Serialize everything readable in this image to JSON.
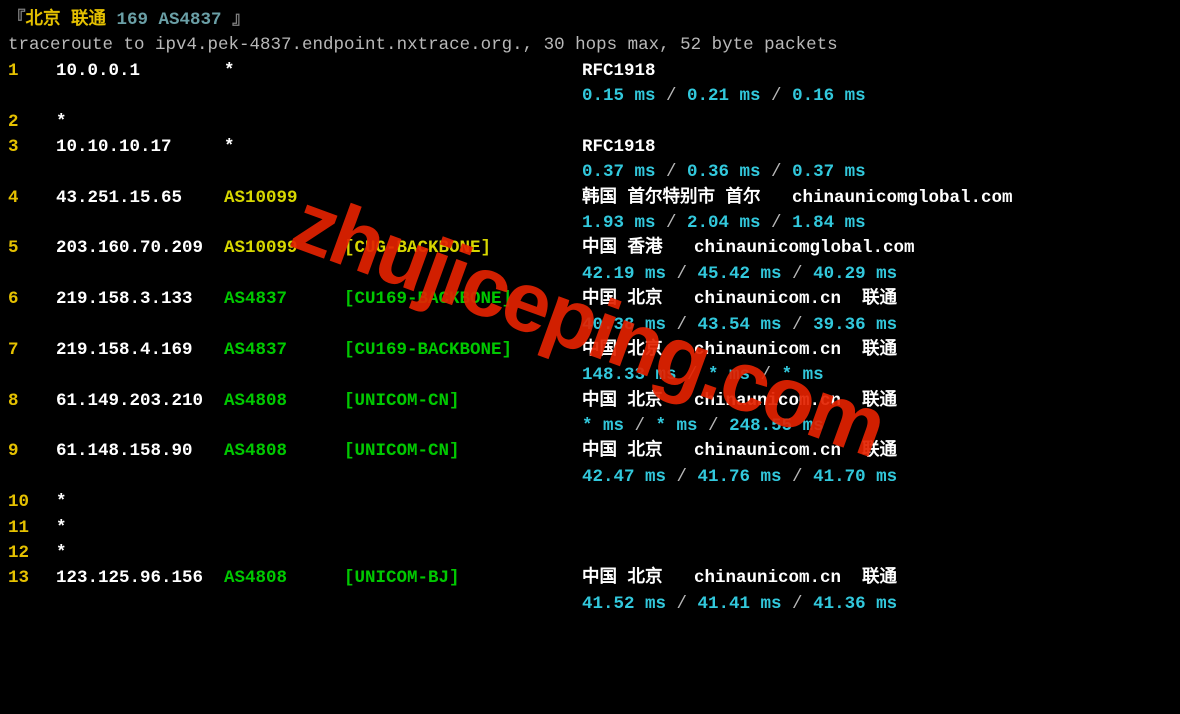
{
  "header": {
    "bracket_l": "『",
    "title_cn": "北京 联通",
    "title_badge": "169 AS4837",
    "bracket_r": "』"
  },
  "cmd": "traceroute to ipv4.pek-4837.endpoint.nxtrace.org., 30 hops max, 52 byte packets",
  "watermark": "zhujiceping.com",
  "hops": [
    {
      "n": "1",
      "ip": "10.0.0.1",
      "asn": "*",
      "asn_color": "white",
      "tag": "",
      "tag_color": "",
      "info": "RFC1918",
      "times": [
        "0.15 ms",
        "0.21 ms",
        "0.16 ms"
      ]
    },
    {
      "n": "2",
      "ip": "*",
      "asn": "",
      "asn_color": "",
      "tag": "",
      "tag_color": "",
      "info": "",
      "times": null
    },
    {
      "n": "3",
      "ip": "10.10.10.17",
      "asn": "*",
      "asn_color": "white",
      "tag": "",
      "tag_color": "",
      "info": "RFC1918",
      "times": [
        "0.37 ms",
        "0.36 ms",
        "0.37 ms"
      ]
    },
    {
      "n": "4",
      "ip": "43.251.15.65",
      "asn": "AS10099",
      "asn_color": "yellow",
      "tag": "",
      "tag_color": "",
      "info": "韩国 首尔特别市 首尔   chinaunicomglobal.com",
      "times": [
        "1.93 ms",
        "2.04 ms",
        "1.84 ms"
      ]
    },
    {
      "n": "5",
      "ip": "203.160.70.209",
      "asn": "AS10099",
      "asn_color": "yellow",
      "tag": "[CUG-BACKBONE]",
      "tag_color": "yellow",
      "info": "中国 香港   chinaunicomglobal.com",
      "times": [
        "42.19 ms",
        "45.42 ms",
        "40.29 ms"
      ]
    },
    {
      "n": "6",
      "ip": "219.158.3.133",
      "asn": "AS4837",
      "asn_color": "green",
      "tag": "[CU169-BACKBONE]",
      "tag_color": "green",
      "info": "中国 北京   chinaunicom.cn  联通",
      "times": [
        "40.38 ms",
        "43.54 ms",
        "39.36 ms"
      ]
    },
    {
      "n": "7",
      "ip": "219.158.4.169",
      "asn": "AS4837",
      "asn_color": "green",
      "tag": "[CU169-BACKBONE]",
      "tag_color": "green",
      "info": "中国 北京   chinaunicom.cn  联通",
      "times": [
        "148.33 ms",
        "* ms",
        "* ms"
      ]
    },
    {
      "n": "8",
      "ip": "61.149.203.210",
      "asn": "AS4808",
      "asn_color": "green",
      "tag": "[UNICOM-CN]",
      "tag_color": "green",
      "info": "中国 北京   chinaunicom.cn  联通",
      "times": [
        "* ms",
        "* ms",
        "248.55 ms"
      ]
    },
    {
      "n": "9",
      "ip": "61.148.158.90",
      "asn": "AS4808",
      "asn_color": "green",
      "tag": "[UNICOM-CN]",
      "tag_color": "green",
      "info": "中国 北京   chinaunicom.cn  联通",
      "times": [
        "42.47 ms",
        "41.76 ms",
        "41.70 ms"
      ]
    },
    {
      "n": "10",
      "ip": "*",
      "asn": "",
      "asn_color": "",
      "tag": "",
      "tag_color": "",
      "info": "",
      "times": null
    },
    {
      "n": "11",
      "ip": "*",
      "asn": "",
      "asn_color": "",
      "tag": "",
      "tag_color": "",
      "info": "",
      "times": null
    },
    {
      "n": "12",
      "ip": "*",
      "asn": "",
      "asn_color": "",
      "tag": "",
      "tag_color": "",
      "info": "",
      "times": null
    },
    {
      "n": "13",
      "ip": "123.125.96.156",
      "asn": "AS4808",
      "asn_color": "green",
      "tag": "[UNICOM-BJ]",
      "tag_color": "green",
      "info": "中国 北京   chinaunicom.cn  联通",
      "times": [
        "41.52 ms",
        "41.41 ms",
        "41.36 ms"
      ]
    }
  ]
}
